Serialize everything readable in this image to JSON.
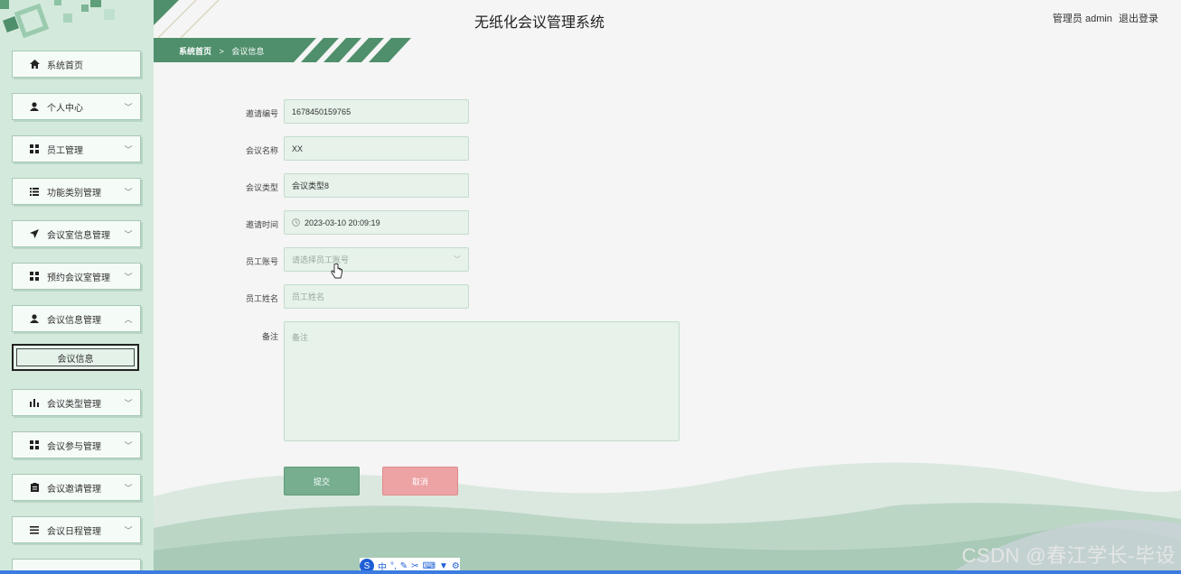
{
  "app": {
    "title": "无纸化会议管理系统",
    "user_label": "管理员 admin",
    "logout_label": "退出登录"
  },
  "breadcrumb": {
    "home": "系统首页",
    "separator": ">",
    "current": "会议信息"
  },
  "sidebar": {
    "items": [
      {
        "label": "系统首页",
        "icon": "home-icon",
        "expandable": false
      },
      {
        "label": "个人中心",
        "icon": "user-icon",
        "expandable": true
      },
      {
        "label": "员工管理",
        "icon": "grid-icon",
        "expandable": true
      },
      {
        "label": "功能类别管理",
        "icon": "list-icon",
        "expandable": true
      },
      {
        "label": "会议室信息管理",
        "icon": "send-icon",
        "expandable": true
      },
      {
        "label": "预约会议室管理",
        "icon": "grid-icon",
        "expandable": true
      },
      {
        "label": "会议信息管理",
        "icon": "user-icon",
        "expandable": true,
        "expanded": true
      },
      {
        "label": "会议类型管理",
        "icon": "bar-chart-icon",
        "expandable": true
      },
      {
        "label": "会议参与管理",
        "icon": "grid-icon",
        "expandable": true
      },
      {
        "label": "会议邀请管理",
        "icon": "clipboard-icon",
        "expandable": true
      },
      {
        "label": "会议日程管理",
        "icon": "list-icon",
        "expandable": true
      }
    ],
    "sub_item": {
      "label": "会议信息"
    }
  },
  "form": {
    "fields": [
      {
        "label": "邀请编号",
        "value": "1678450159765",
        "placeholder": ""
      },
      {
        "label": "会议名称",
        "value": "XX",
        "placeholder": ""
      },
      {
        "label": "会议类型",
        "value": "会议类型8",
        "placeholder": ""
      },
      {
        "label": "邀请时间",
        "value": "2023-03-10 20:09:19",
        "placeholder": ""
      },
      {
        "label": "员工账号",
        "value": "",
        "placeholder": "请选择员工账号"
      },
      {
        "label": "员工姓名",
        "value": "",
        "placeholder": "员工姓名"
      }
    ],
    "remark": {
      "label": "备注",
      "placeholder": "备注"
    },
    "submit_label": "提交",
    "cancel_label": "取消"
  },
  "colors": {
    "accent": "#4f8f6c",
    "sidebar_bg": "#d3e9dc",
    "submit": "#76ae8f",
    "cancel": "#eda2a4"
  },
  "watermark": "CSDN @春江学长-毕设"
}
